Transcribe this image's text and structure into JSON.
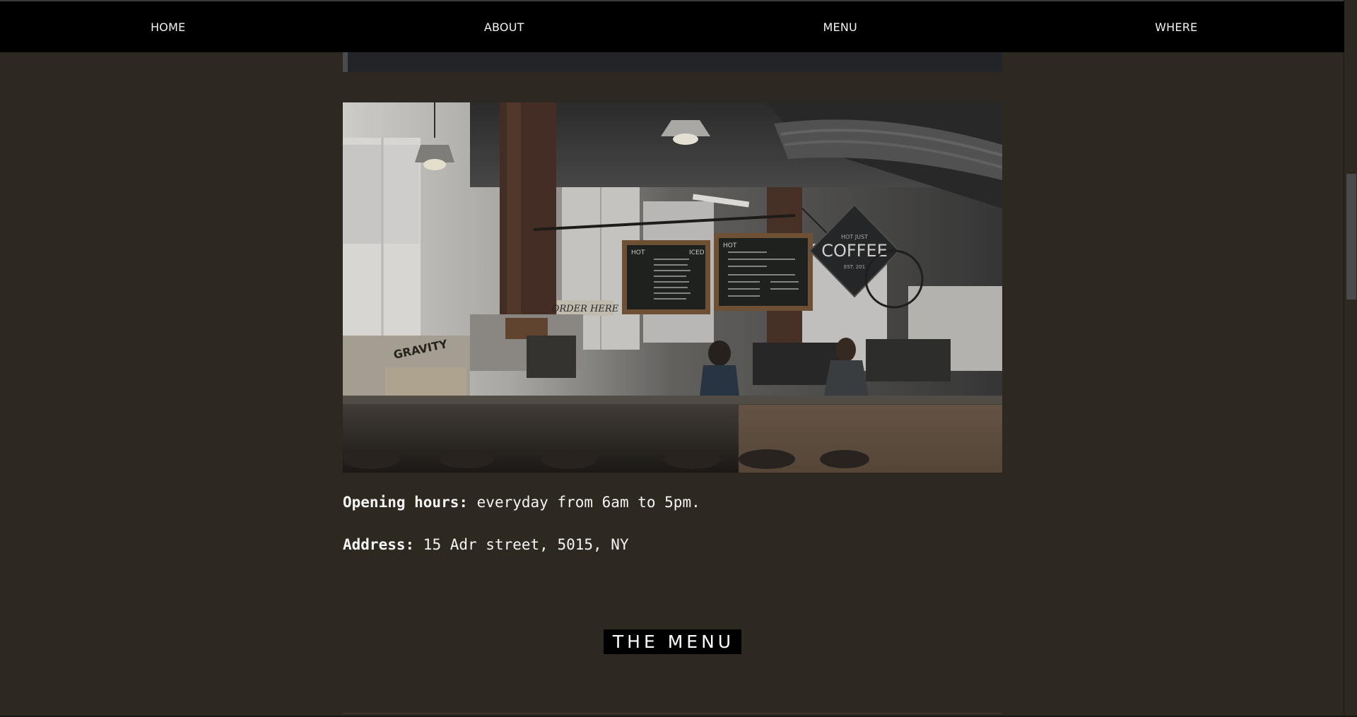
{
  "nav": {
    "items": [
      {
        "label": "HOME"
      },
      {
        "label": "ABOUT"
      },
      {
        "label": "MENU"
      },
      {
        "label": "WHERE"
      }
    ]
  },
  "photo": {
    "signs": {
      "coffee_top": "HOT JUST",
      "coffee_main": "COFFEE",
      "coffee_bottom": "EST. 201",
      "order_here": "ORDER HERE",
      "crate": "GRAVITY",
      "board_hot": "HOT",
      "board_iced": "ICED"
    }
  },
  "info": {
    "hours_label": "Opening hours:",
    "hours_value": " everyday from 6am to 5pm.",
    "address_label": "Address:",
    "address_value": " 15 Adr street, 5015, NY"
  },
  "menu_section": {
    "heading": "THE MENU"
  },
  "colors": {
    "page_background": "#2d2920",
    "navbar_background": "#000000",
    "heading_background": "#000000",
    "text": "#ffffff"
  }
}
